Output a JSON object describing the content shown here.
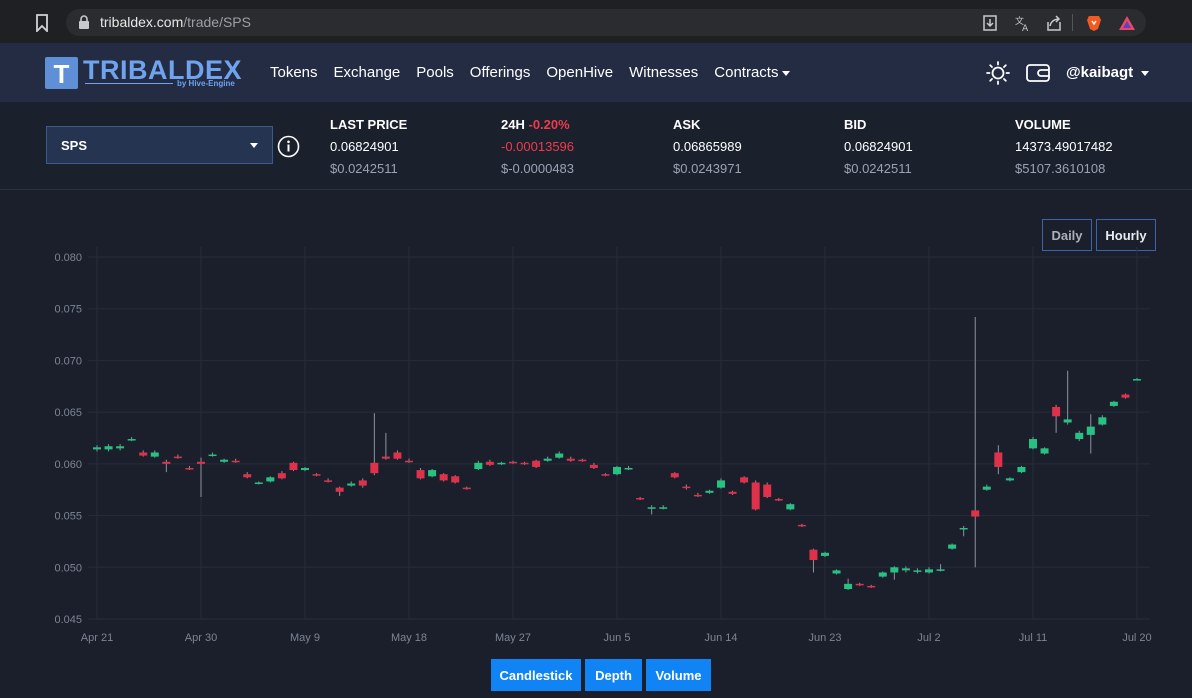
{
  "browser": {
    "url_domain": "tribaldex.com",
    "url_path": "/trade/SPS",
    "icons": [
      "bookmark-icon",
      "lock-icon",
      "download-icon",
      "translate-icon",
      "share-icon",
      "brave-lion-icon",
      "brave-rewards-icon"
    ]
  },
  "nav": {
    "logo_mark": "T",
    "logo_word": "TRIBALDEX",
    "logo_sub": "by Hive-Engine",
    "links": [
      "Tokens",
      "Exchange",
      "Pools",
      "Offerings",
      "OpenHive",
      "Witnesses",
      "Contracts"
    ],
    "user": "@kaibagt",
    "icons": [
      "sun-icon",
      "wallet-icon"
    ]
  },
  "ticker": {
    "token": "SPS",
    "last_price": {
      "label": "LAST PRICE",
      "value": "0.06824901",
      "usd": "$0.0242511"
    },
    "change_24h": {
      "label": "24H",
      "pct": "-0.20%",
      "value": "-0.00013596",
      "usd": "$-0.0000483"
    },
    "ask": {
      "label": "ASK",
      "value": "0.06865989",
      "usd": "$0.0243971"
    },
    "bid": {
      "label": "BID",
      "value": "0.06824901",
      "usd": "$0.0242511"
    },
    "volume": {
      "label": "VOLUME",
      "value": "14373.49017482",
      "usd": "$5107.3610108"
    }
  },
  "range": {
    "daily": "Daily",
    "hourly": "Hourly",
    "selected": "Hourly"
  },
  "view_buttons": [
    "Candlestick",
    "Depth",
    "Volume"
  ],
  "colors": {
    "up": "#26c281",
    "down": "#e0314b",
    "accent": "#1083f5",
    "nav_bg": "#242c43"
  },
  "chart_data": {
    "type": "candlestick",
    "x": [
      "Apr 21",
      "Apr 30",
      "May 9",
      "May 18",
      "May 27",
      "Jun 5",
      "Jun 14",
      "Jun 23",
      "Jul 2",
      "Jul 11",
      "Jul 20"
    ],
    "ylim": [
      0.045,
      0.08
    ],
    "y_ticks": [
      "0.080",
      "0.075",
      "0.070",
      "0.065",
      "0.060",
      "0.055",
      "0.050",
      "0.045"
    ],
    "grid": true,
    "candles": [
      {
        "d": 0,
        "o": 0.0614,
        "c": 0.0616,
        "h": 0.0618,
        "l": 0.0612
      },
      {
        "d": 1,
        "o": 0.0614,
        "c": 0.0617,
        "h": 0.0619,
        "l": 0.0612
      },
      {
        "d": 2,
        "o": 0.0615,
        "c": 0.0617,
        "h": 0.0619,
        "l": 0.0613
      },
      {
        "d": 3,
        "o": 0.0623,
        "c": 0.0624,
        "h": 0.0626,
        "l": 0.0622
      },
      {
        "d": 4,
        "o": 0.0611,
        "c": 0.0608,
        "h": 0.0613,
        "l": 0.0607
      },
      {
        "d": 5,
        "o": 0.0607,
        "c": 0.0611,
        "h": 0.0613,
        "l": 0.0606
      },
      {
        "d": 6,
        "o": 0.0602,
        "c": 0.06,
        "h": 0.0604,
        "l": 0.0592
      },
      {
        "d": 7,
        "o": 0.0607,
        "c": 0.0606,
        "h": 0.0609,
        "l": 0.0605
      },
      {
        "d": 8,
        "o": 0.0596,
        "c": 0.0595,
        "h": 0.0598,
        "l": 0.0594
      },
      {
        "d": 9,
        "o": 0.0602,
        "c": 0.06,
        "h": 0.0606,
        "l": 0.0568
      },
      {
        "d": 10,
        "o": 0.0608,
        "c": 0.0609,
        "h": 0.0611,
        "l": 0.0607
      },
      {
        "d": 11,
        "o": 0.0602,
        "c": 0.0604,
        "h": 0.0605,
        "l": 0.0601
      },
      {
        "d": 12,
        "o": 0.0603,
        "c": 0.0602,
        "h": 0.0605,
        "l": 0.0601
      },
      {
        "d": 13,
        "o": 0.059,
        "c": 0.0587,
        "h": 0.0592,
        "l": 0.0586
      },
      {
        "d": 14,
        "o": 0.0581,
        "c": 0.0582,
        "h": 0.0583,
        "l": 0.058
      },
      {
        "d": 15,
        "o": 0.0583,
        "c": 0.0587,
        "h": 0.0588,
        "l": 0.0582
      },
      {
        "d": 16,
        "o": 0.0591,
        "c": 0.0586,
        "h": 0.0593,
        "l": 0.0585
      },
      {
        "d": 17,
        "o": 0.0601,
        "c": 0.0594,
        "h": 0.0602,
        "l": 0.0593
      },
      {
        "d": 18,
        "o": 0.0594,
        "c": 0.0596,
        "h": 0.0597,
        "l": 0.0593
      },
      {
        "d": 19,
        "o": 0.059,
        "c": 0.0589,
        "h": 0.0591,
        "l": 0.0588
      },
      {
        "d": 20,
        "o": 0.0584,
        "c": 0.0583,
        "h": 0.0586,
        "l": 0.0582
      },
      {
        "d": 21,
        "o": 0.0577,
        "c": 0.0573,
        "h": 0.0578,
        "l": 0.0569
      },
      {
        "d": 22,
        "o": 0.0579,
        "c": 0.0581,
        "h": 0.0583,
        "l": 0.0578
      },
      {
        "d": 23,
        "o": 0.0584,
        "c": 0.0579,
        "h": 0.0586,
        "l": 0.0577
      },
      {
        "d": 24,
        "o": 0.0601,
        "c": 0.0591,
        "h": 0.0649,
        "l": 0.0589
      },
      {
        "d": 25,
        "o": 0.0607,
        "c": 0.0605,
        "h": 0.063,
        "l": 0.0604
      },
      {
        "d": 26,
        "o": 0.0611,
        "c": 0.0605,
        "h": 0.0613,
        "l": 0.0604
      },
      {
        "d": 27,
        "o": 0.0603,
        "c": 0.0602,
        "h": 0.0605,
        "l": 0.0601
      },
      {
        "d": 28,
        "o": 0.0594,
        "c": 0.0586,
        "h": 0.0596,
        "l": 0.0585
      },
      {
        "d": 29,
        "o": 0.0588,
        "c": 0.0594,
        "h": 0.0595,
        "l": 0.0587
      },
      {
        "d": 30,
        "o": 0.059,
        "c": 0.0584,
        "h": 0.0591,
        "l": 0.0583
      },
      {
        "d": 31,
        "o": 0.0588,
        "c": 0.0582,
        "h": 0.0589,
        "l": 0.0581
      },
      {
        "d": 32,
        "o": 0.0577,
        "c": 0.0576,
        "h": 0.0578,
        "l": 0.0575
      },
      {
        "d": 33,
        "o": 0.0595,
        "c": 0.0601,
        "h": 0.0603,
        "l": 0.0594
      },
      {
        "d": 34,
        "o": 0.0602,
        "c": 0.0599,
        "h": 0.0604,
        "l": 0.0598
      },
      {
        "d": 35,
        "o": 0.06,
        "c": 0.0601,
        "h": 0.0602,
        "l": 0.0599
      },
      {
        "d": 36,
        "o": 0.0602,
        "c": 0.0601,
        "h": 0.0603,
        "l": 0.06
      },
      {
        "d": 37,
        "o": 0.0601,
        "c": 0.06,
        "h": 0.0602,
        "l": 0.0599
      },
      {
        "d": 38,
        "o": 0.0603,
        "c": 0.0597,
        "h": 0.0604,
        "l": 0.0596
      },
      {
        "d": 39,
        "o": 0.0603,
        "c": 0.0605,
        "h": 0.0607,
        "l": 0.0602
      },
      {
        "d": 40,
        "o": 0.0606,
        "c": 0.061,
        "h": 0.0612,
        "l": 0.0605
      },
      {
        "d": 41,
        "o": 0.0605,
        "c": 0.0603,
        "h": 0.0607,
        "l": 0.0602
      },
      {
        "d": 42,
        "o": 0.0604,
        "c": 0.0603,
        "h": 0.0605,
        "l": 0.0602
      },
      {
        "d": 43,
        "o": 0.0599,
        "c": 0.0596,
        "h": 0.0601,
        "l": 0.0595
      },
      {
        "d": 44,
        "o": 0.059,
        "c": 0.0589,
        "h": 0.0591,
        "l": 0.0588
      },
      {
        "d": 45,
        "o": 0.059,
        "c": 0.0597,
        "h": 0.0598,
        "l": 0.0589
      },
      {
        "d": 46,
        "o": 0.0595,
        "c": 0.0596,
        "h": 0.0598,
        "l": 0.0594
      },
      {
        "d": 47,
        "o": 0.0567,
        "c": 0.0566,
        "h": 0.0568,
        "l": 0.0565
      },
      {
        "d": 48,
        "o": 0.0557,
        "c": 0.0558,
        "h": 0.056,
        "l": 0.0551
      },
      {
        "d": 49,
        "o": 0.0557,
        "c": 0.0558,
        "h": 0.056,
        "l": 0.0556
      },
      {
        "d": 50,
        "o": 0.0591,
        "c": 0.0587,
        "h": 0.0592,
        "l": 0.0586
      },
      {
        "d": 51,
        "o": 0.0578,
        "c": 0.0577,
        "h": 0.058,
        "l": 0.0575
      },
      {
        "d": 52,
        "o": 0.057,
        "c": 0.0569,
        "h": 0.0572,
        "l": 0.0568
      },
      {
        "d": 53,
        "o": 0.0572,
        "c": 0.0574,
        "h": 0.0575,
        "l": 0.0571
      },
      {
        "d": 54,
        "o": 0.0577,
        "c": 0.0584,
        "h": 0.0586,
        "l": 0.0576
      },
      {
        "d": 55,
        "o": 0.0573,
        "c": 0.0571,
        "h": 0.0574,
        "l": 0.057
      },
      {
        "d": 56,
        "o": 0.0587,
        "c": 0.0582,
        "h": 0.0588,
        "l": 0.0581
      },
      {
        "d": 57,
        "o": 0.0582,
        "c": 0.0556,
        "h": 0.0584,
        "l": 0.0555
      },
      {
        "d": 58,
        "o": 0.058,
        "c": 0.0568,
        "h": 0.0582,
        "l": 0.0567
      },
      {
        "d": 59,
        "o": 0.0566,
        "c": 0.0565,
        "h": 0.0567,
        "l": 0.0564
      },
      {
        "d": 60,
        "o": 0.0556,
        "c": 0.0561,
        "h": 0.0562,
        "l": 0.0555
      },
      {
        "d": 61,
        "o": 0.0541,
        "c": 0.054,
        "h": 0.0542,
        "l": 0.0539
      },
      {
        "d": 62,
        "o": 0.0517,
        "c": 0.0507,
        "h": 0.0518,
        "l": 0.0495
      },
      {
        "d": 63,
        "o": 0.0511,
        "c": 0.0514,
        "h": 0.0515,
        "l": 0.051
      },
      {
        "d": 64,
        "o": 0.0494,
        "c": 0.0497,
        "h": 0.0498,
        "l": 0.0493
      },
      {
        "d": 65,
        "o": 0.0479,
        "c": 0.0484,
        "h": 0.0489,
        "l": 0.0478
      },
      {
        "d": 66,
        "o": 0.0484,
        "c": 0.0483,
        "h": 0.0485,
        "l": 0.0482
      },
      {
        "d": 67,
        "o": 0.0482,
        "c": 0.0481,
        "h": 0.0483,
        "l": 0.048
      },
      {
        "d": 68,
        "o": 0.0491,
        "c": 0.0495,
        "h": 0.0496,
        "l": 0.049
      },
      {
        "d": 69,
        "o": 0.0495,
        "c": 0.05,
        "h": 0.0501,
        "l": 0.0488
      },
      {
        "d": 70,
        "o": 0.0497,
        "c": 0.0499,
        "h": 0.0501,
        "l": 0.0495
      },
      {
        "d": 71,
        "o": 0.0496,
        "c": 0.0497,
        "h": 0.0499,
        "l": 0.0494
      },
      {
        "d": 72,
        "o": 0.0495,
        "c": 0.0498,
        "h": 0.05,
        "l": 0.0494
      },
      {
        "d": 73,
        "o": 0.0497,
        "c": 0.0498,
        "h": 0.0503,
        "l": 0.0496
      },
      {
        "d": 74,
        "o": 0.0518,
        "c": 0.0522,
        "h": 0.0523,
        "l": 0.0517
      },
      {
        "d": 75,
        "o": 0.0537,
        "c": 0.0538,
        "h": 0.054,
        "l": 0.053
      },
      {
        "d": 76,
        "o": 0.0555,
        "c": 0.0549,
        "h": 0.0742,
        "l": 0.05
      },
      {
        "d": 77,
        "o": 0.0575,
        "c": 0.0578,
        "h": 0.058,
        "l": 0.0574
      },
      {
        "d": 78,
        "o": 0.0611,
        "c": 0.0597,
        "h": 0.0618,
        "l": 0.059
      },
      {
        "d": 79,
        "o": 0.0584,
        "c": 0.0586,
        "h": 0.0587,
        "l": 0.0583
      },
      {
        "d": 80,
        "o": 0.0592,
        "c": 0.0597,
        "h": 0.0598,
        "l": 0.0591
      },
      {
        "d": 81,
        "o": 0.0615,
        "c": 0.0624,
        "h": 0.0626,
        "l": 0.0614
      },
      {
        "d": 82,
        "o": 0.061,
        "c": 0.0615,
        "h": 0.0616,
        "l": 0.0609
      },
      {
        "d": 83,
        "o": 0.0655,
        "c": 0.0646,
        "h": 0.0657,
        "l": 0.063
      },
      {
        "d": 84,
        "o": 0.064,
        "c": 0.0643,
        "h": 0.069,
        "l": 0.0638
      },
      {
        "d": 85,
        "o": 0.0624,
        "c": 0.063,
        "h": 0.0632,
        "l": 0.0622
      },
      {
        "d": 86,
        "o": 0.0628,
        "c": 0.0636,
        "h": 0.0648,
        "l": 0.061
      },
      {
        "d": 87,
        "o": 0.0638,
        "c": 0.0645,
        "h": 0.0647,
        "l": 0.0637
      },
      {
        "d": 88,
        "o": 0.0656,
        "c": 0.066,
        "h": 0.0661,
        "l": 0.0655
      },
      {
        "d": 89,
        "o": 0.0667,
        "c": 0.0664,
        "h": 0.0668,
        "l": 0.0663
      },
      {
        "d": 90,
        "o": 0.0682,
        "c": 0.0682,
        "h": 0.0683,
        "l": 0.0682
      }
    ]
  }
}
